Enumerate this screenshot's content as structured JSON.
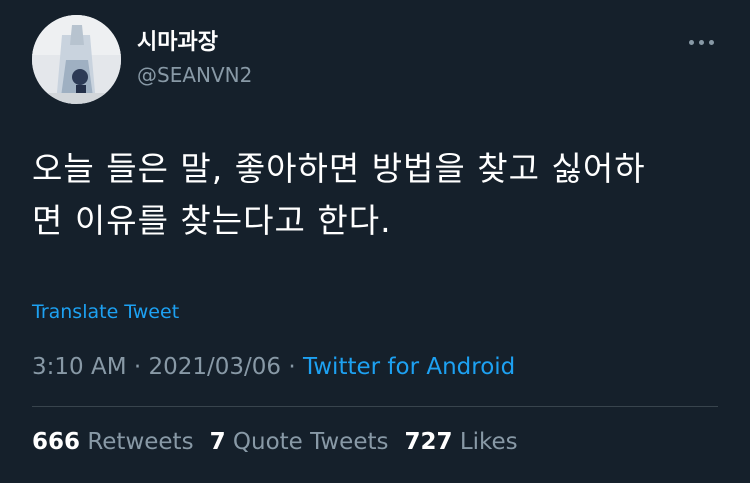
{
  "author": {
    "display_name": "시마과장",
    "handle": "@SEANVN2",
    "avatar_icon": "profile-photo"
  },
  "menu": {
    "icon": "more-horizontal-icon"
  },
  "tweet": {
    "text": "오늘 들은 말, 좋아하면 방법을 찾고 싫어하\n면 이유를 찾는다고 한다.",
    "translate_label": "Translate Tweet"
  },
  "meta": {
    "time": "3:10 AM",
    "sep1": " · ",
    "date": "2021/03/06",
    "sep2": " · ",
    "source": "Twitter for Android"
  },
  "stats": {
    "retweets_count": "666",
    "retweets_label": "Retweets",
    "quotes_count": "7",
    "quotes_label": "Quote Tweets",
    "likes_count": "727",
    "likes_label": "Likes"
  },
  "colors": {
    "background": "#15202b",
    "primary_text": "#ffffff",
    "secondary_text": "#8899a6",
    "accent": "#1da1f2",
    "divider": "#38444d"
  }
}
